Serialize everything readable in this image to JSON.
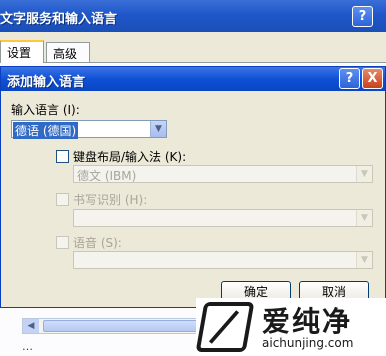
{
  "background_window": {
    "title": "文字服务和输入语言",
    "help_label": "?",
    "close_label": "X",
    "tabs": [
      {
        "label": "设置"
      },
      {
        "label": "高级"
      }
    ],
    "scroll_left": "◀",
    "scroll_right": "▶",
    "bottom_text": "…"
  },
  "dialog": {
    "title": "添加输入语言",
    "help_label": "?",
    "close_label": "X",
    "input_language": {
      "label": "输入语言 (I):",
      "value": "德语 (德国)"
    },
    "keyboard": {
      "label": "键盘布局/输入法 (K):",
      "value": "德文 (IBM)",
      "checked": false
    },
    "handwriting": {
      "label": "书写识别 (H):",
      "value": "",
      "checked": false
    },
    "speech": {
      "label": "语音 (S):",
      "value": "",
      "checked": false
    },
    "ok_label": "确定",
    "cancel_label": "取消",
    "dropdown_arrow": "▼"
  },
  "watermark": {
    "brand_text": "爱纯净",
    "url": "aichunjing.com"
  }
}
